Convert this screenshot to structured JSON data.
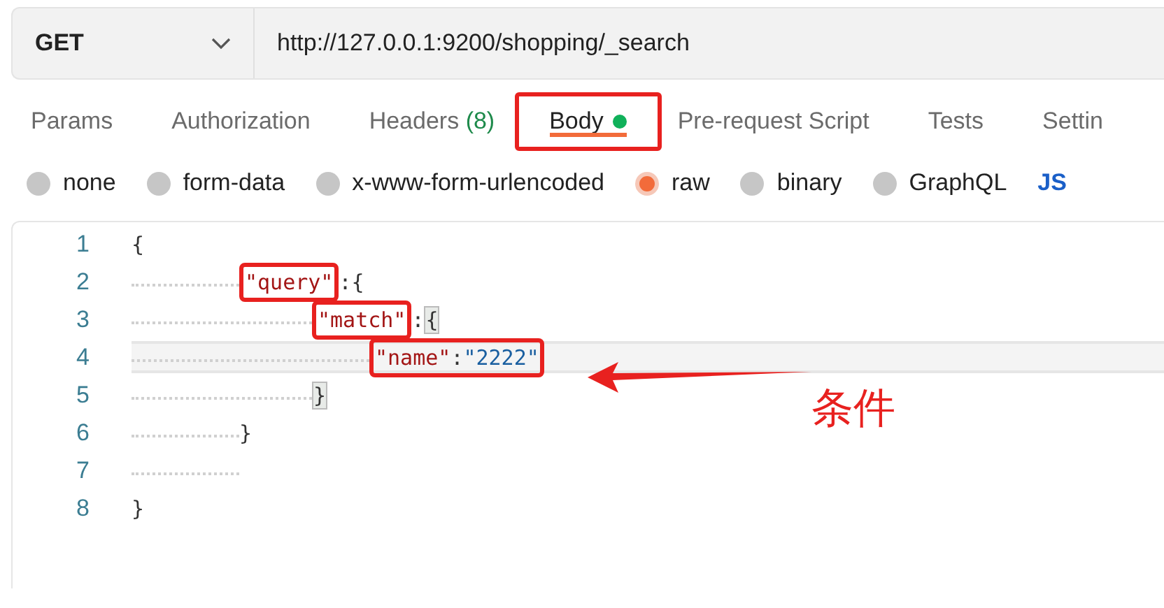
{
  "request": {
    "method": "GET",
    "url": "http://127.0.0.1:9200/shopping/_search"
  },
  "tabs": [
    {
      "label": "Params",
      "selected": false,
      "dot": false,
      "boxed": false
    },
    {
      "label": "Authorization",
      "selected": false,
      "dot": false,
      "boxed": false
    },
    {
      "label": "Headers",
      "count": "(8)",
      "selected": false,
      "dot": false,
      "boxed": false
    },
    {
      "label": "Body",
      "selected": true,
      "dot": true,
      "boxed": true
    },
    {
      "label": "Pre-request Script",
      "selected": false,
      "dot": false,
      "boxed": false
    },
    {
      "label": "Tests",
      "selected": false,
      "dot": false,
      "boxed": false
    },
    {
      "label": "Settin",
      "selected": false,
      "dot": false,
      "boxed": false
    }
  ],
  "body_types": [
    {
      "label": "none",
      "selected": false
    },
    {
      "label": "form-data",
      "selected": false
    },
    {
      "label": "x-www-form-urlencoded",
      "selected": false
    },
    {
      "label": "raw",
      "selected": true
    },
    {
      "label": "binary",
      "selected": false
    },
    {
      "label": "GraphQL",
      "selected": false
    }
  ],
  "format_dropdown": "JS",
  "editor": {
    "lines": [
      {
        "number": "1",
        "active": false,
        "tokens": [
          {
            "kind": "brace",
            "text": "{",
            "boxed": false
          }
        ]
      },
      {
        "number": "2",
        "active": false,
        "tokens": [
          {
            "kind": "key",
            "text": "\"query\"",
            "boxed": true
          },
          {
            "kind": "punct",
            "text": ":",
            "boxed": false
          },
          {
            "kind": "brace",
            "text": "{",
            "boxed": false
          }
        ]
      },
      {
        "number": "3",
        "active": false,
        "tokens": [
          {
            "kind": "key",
            "text": "\"match\"",
            "boxed": true
          },
          {
            "kind": "punct",
            "text": ":",
            "boxed": false
          },
          {
            "kind": "brace-match",
            "text": "{",
            "boxed": false
          }
        ]
      },
      {
        "number": "4",
        "active": true,
        "tokens": [
          {
            "kind": "key",
            "text": "\"name\"",
            "boxed": true
          },
          {
            "kind": "punct",
            "text": ":",
            "boxed": true
          },
          {
            "kind": "string",
            "text": "\"2222\"",
            "boxed": true
          }
        ]
      },
      {
        "number": "5",
        "active": false,
        "tokens": [
          {
            "kind": "brace-match",
            "text": "}",
            "boxed": false
          }
        ]
      },
      {
        "number": "6",
        "active": false,
        "tokens": [
          {
            "kind": "brace",
            "text": "}",
            "boxed": false
          }
        ]
      },
      {
        "number": "7",
        "active": false
      },
      {
        "number": "8",
        "active": false,
        "tokens": [
          {
            "kind": "brace",
            "text": "}",
            "boxed": false
          }
        ]
      }
    ]
  },
  "annotation": {
    "label": "条件"
  }
}
